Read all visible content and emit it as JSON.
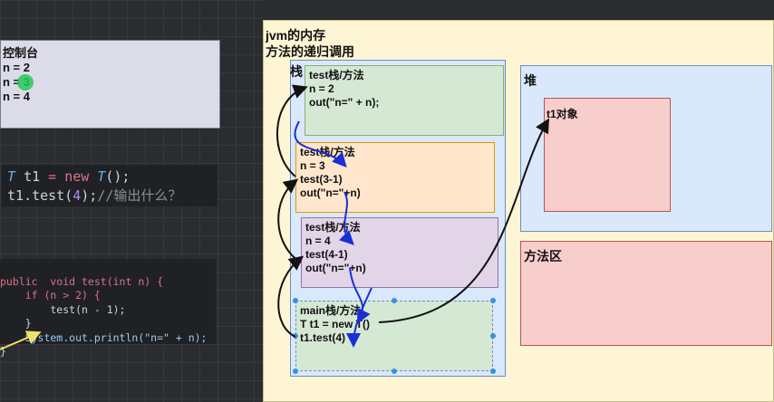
{
  "console": {
    "title": "控制台",
    "lines": [
      "n = 2",
      "n = 3",
      "n = 4"
    ]
  },
  "code_snippet": {
    "line1": {
      "type": "T",
      "var": "t1",
      "eq": "=",
      "new": "new",
      "ctor": "T",
      "rest": "();"
    },
    "line2": {
      "obj": "t1",
      "call": ".test(",
      "arg": "4",
      "close": ");",
      "comment": "//输出什么？"
    }
  },
  "method_code": {
    "lines": [
      "public  void test(int n) {",
      "    if (n > 2) {",
      "        test(n - 1);",
      "    }",
      "    System.out.println(\"n=\" + n);",
      "}"
    ]
  },
  "diagram": {
    "title_line1": "jvm的内存",
    "title_line2": "方法的递归调用",
    "stack_label": "栈",
    "heap_label": "堆",
    "method_area_label": "方法区",
    "object_label": "t1对象",
    "frames": [
      {
        "lines": [
          "test栈/方法",
          "n = 2",
          "out(\"n=\" + n);"
        ]
      },
      {
        "lines": [
          "test栈/方法",
          "n = 3",
          "test(3-1)",
          "out(\"n=\"+n)"
        ]
      },
      {
        "lines": [
          "test栈/方法",
          "n = 4",
          "test(4-1)",
          "out(\"n=\"+n)"
        ]
      },
      {
        "lines": [
          "main栈/方法",
          "T t1 = new T()",
          "t1.test(4)"
        ]
      }
    ]
  }
}
